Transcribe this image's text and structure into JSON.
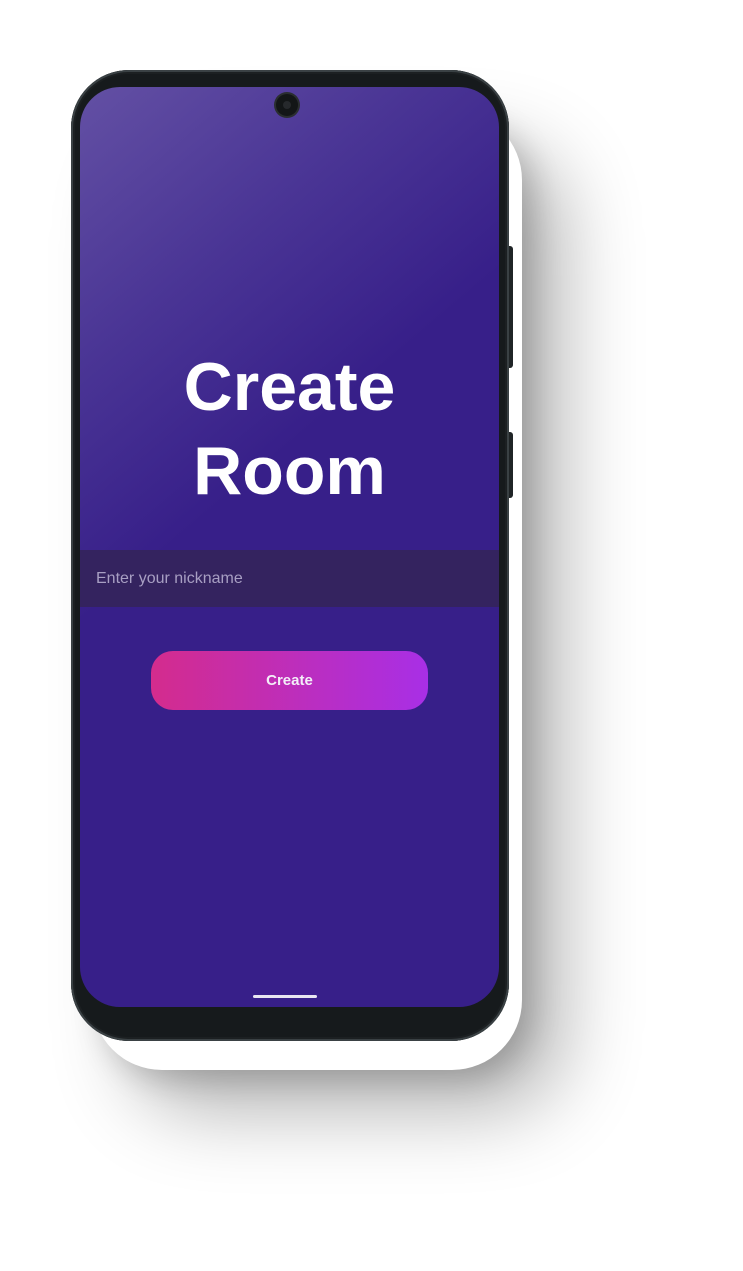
{
  "screen": {
    "title_line1": "Create",
    "title_line2": "Room",
    "nickname_placeholder": "Enter your nickname",
    "nickname_value": "",
    "create_button_label": "Create"
  },
  "colors": {
    "background_primary": "#371f89",
    "background_highlight": "#6350a4",
    "input_background": "#34235f",
    "button_gradient_start": "#d42c8d",
    "button_gradient_end": "#a82fe6",
    "text_primary": "#ffffff"
  },
  "icons": {
    "camera": "front-camera-icon"
  }
}
